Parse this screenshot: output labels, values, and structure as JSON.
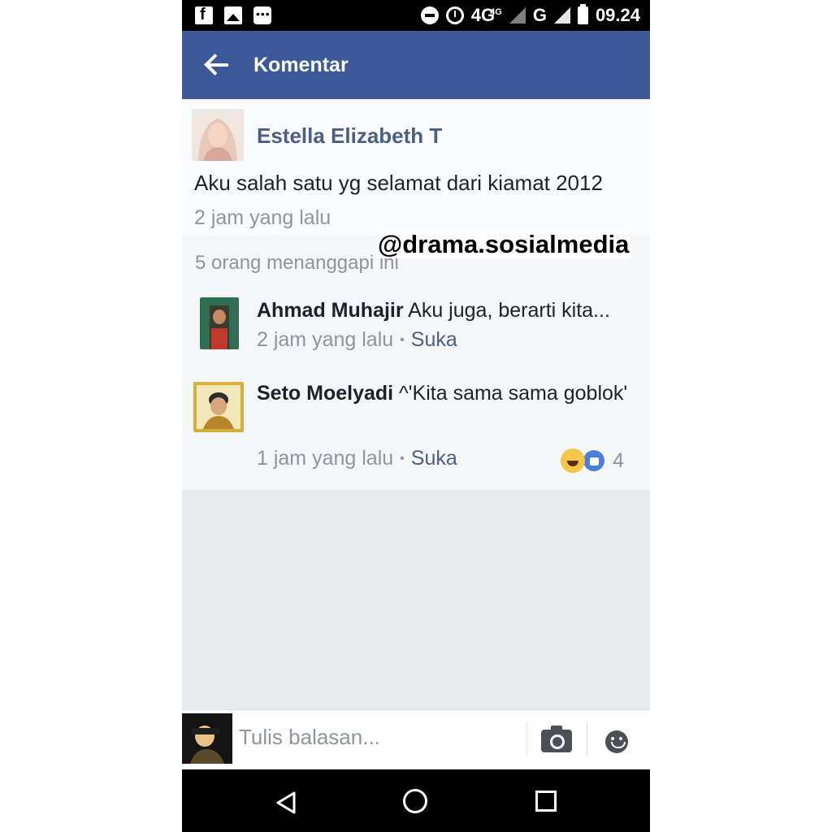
{
  "status_bar": {
    "network": "4G",
    "network_sup": "4G",
    "network2": "G",
    "time": "09.24"
  },
  "header": {
    "title": "Komentar"
  },
  "post": {
    "author": "Estella Elizabeth T",
    "text": "Aku salah satu yg selamat dari kiamat 2012",
    "time": "2 jam yang lalu"
  },
  "watermark": "@drama.sosialmedia",
  "replies": {
    "count_text": "5 orang menanggapi ini",
    "items": [
      {
        "name": "Ahmad Muhajir",
        "text": "Aku juga, berarti kita...",
        "time": "2 jam yang lalu",
        "separator": "•",
        "like": "Suka"
      },
      {
        "name": "Seto Moelyadi",
        "text": "^'Kita sama sama goblok'",
        "time": "1 jam yang lalu",
        "separator": "•",
        "like": "Suka",
        "reaction_count": "4"
      }
    ]
  },
  "composer": {
    "placeholder": "Tulis balasan..."
  },
  "colors": {
    "brand": "#3b5998",
    "link": "#4b5f85",
    "meta": "#90949c"
  }
}
